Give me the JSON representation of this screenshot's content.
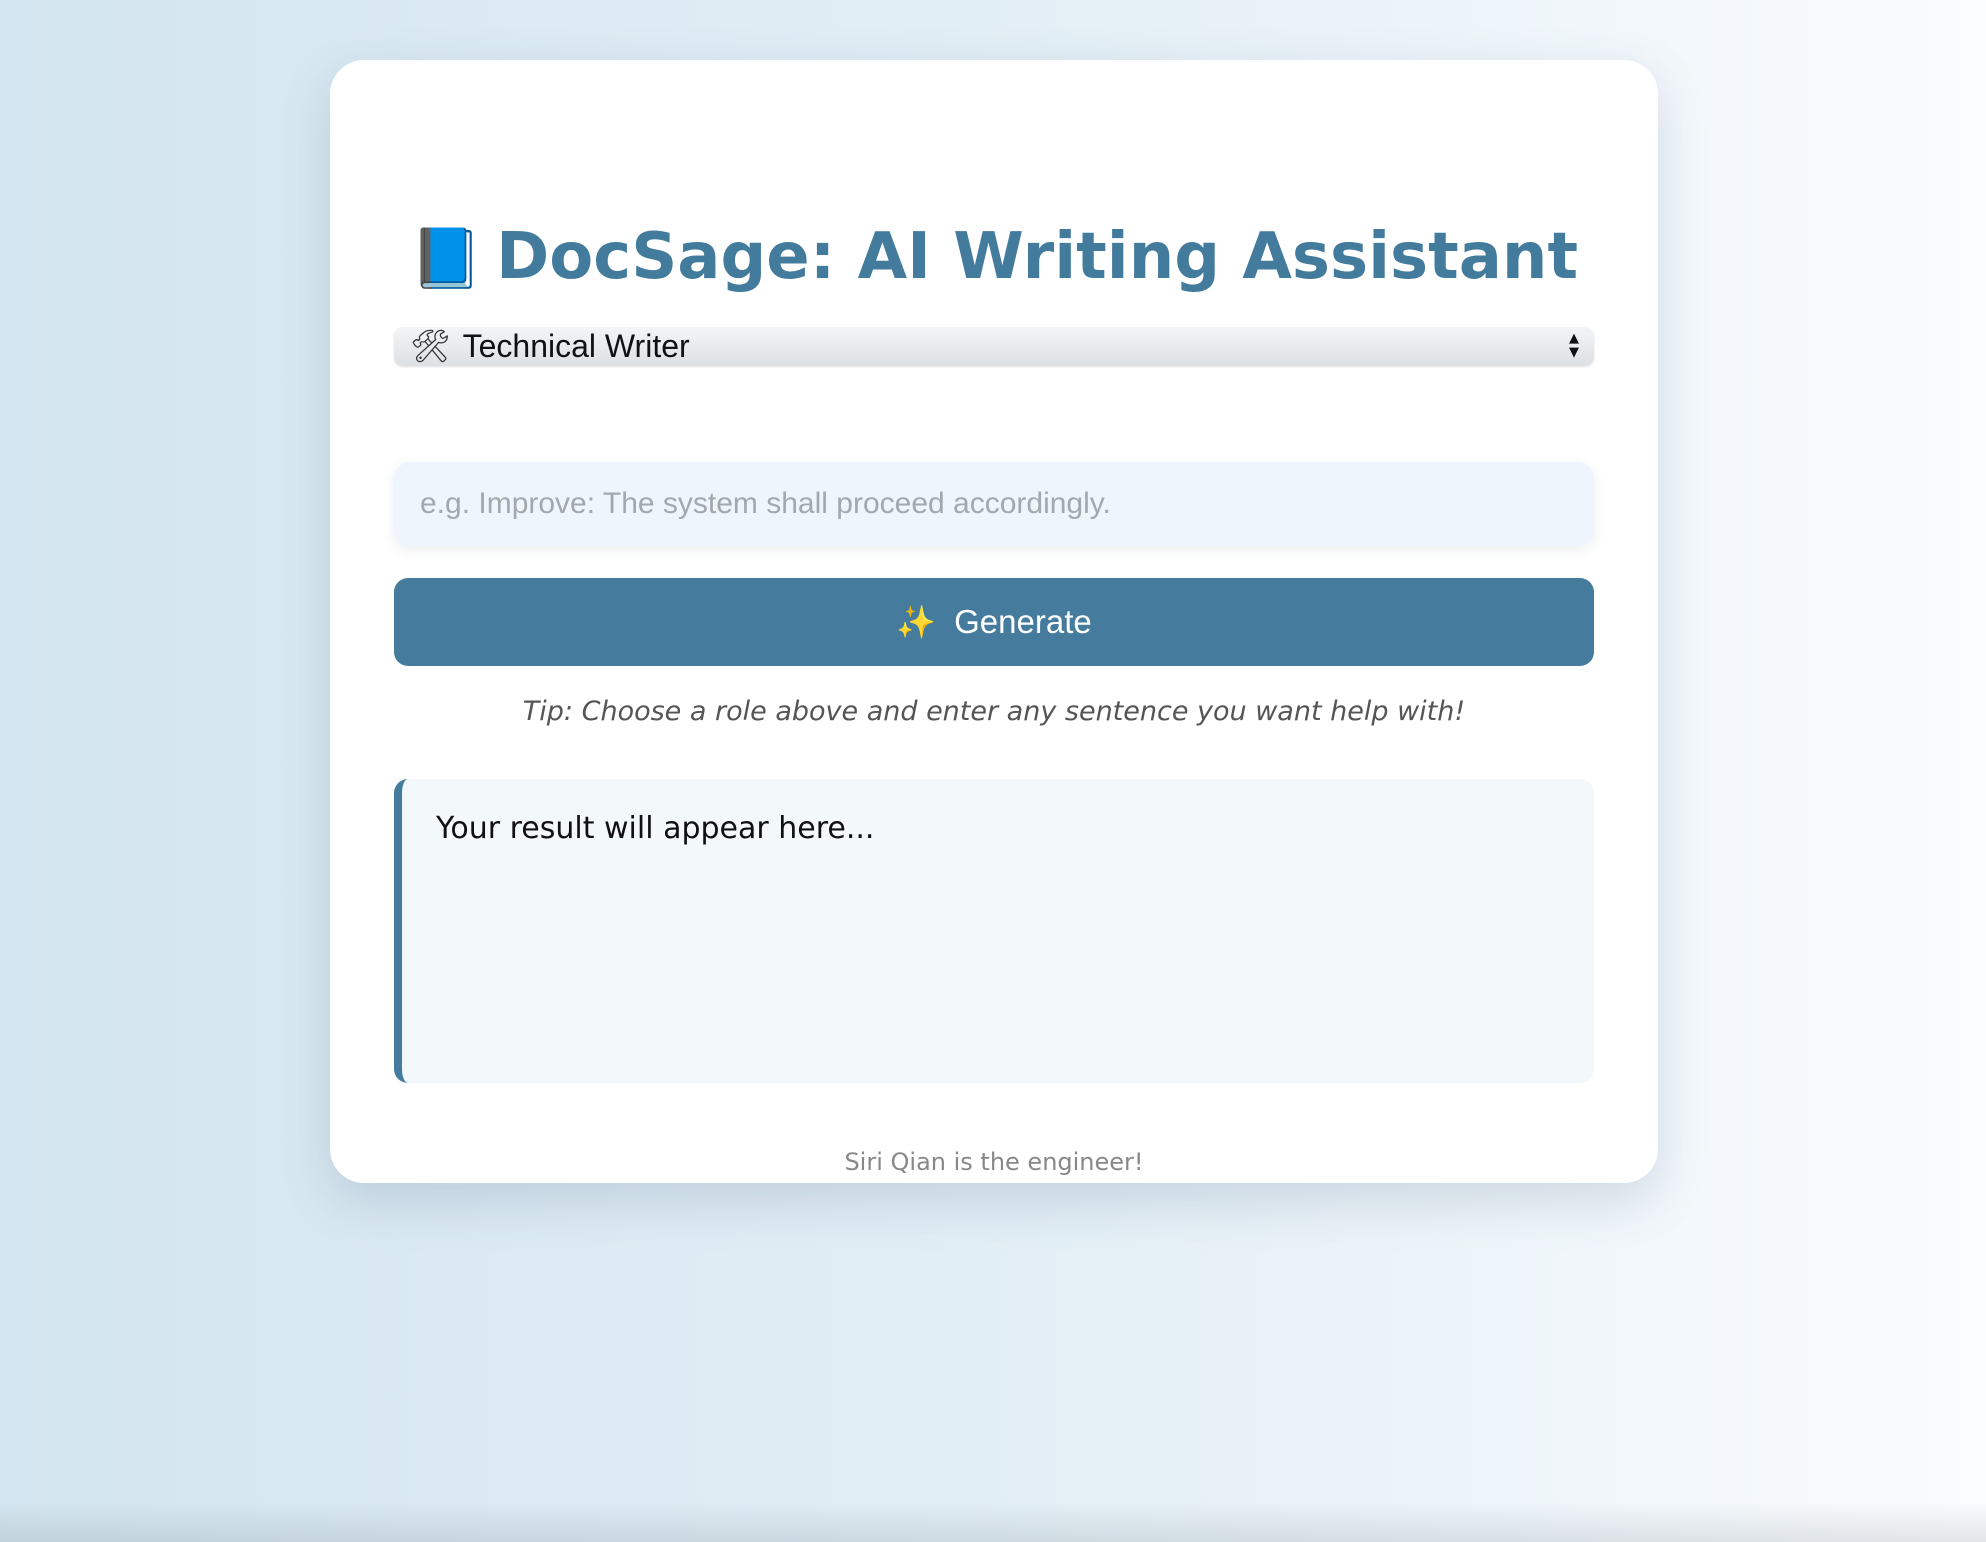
{
  "header": {
    "icon": "blue-book-icon",
    "title": "DocSage: AI Writing Assistant"
  },
  "role_select": {
    "icon": "hammer-wrench-icon",
    "selected": "Technical Writer"
  },
  "prompt": {
    "value": "",
    "placeholder": "e.g. Improve: The system shall proceed accordingly."
  },
  "generate_button": {
    "icon": "sparkles-icon",
    "label": "Generate"
  },
  "tip": "Tip: Choose a role above and enter any sentence you want help with!",
  "result": {
    "text": "Your result will appear here..."
  },
  "footer": "Siri Qian is the engineer!",
  "colors": {
    "accent": "#457b9d",
    "title": "#437b9d",
    "input_bg": "#eef5fc",
    "result_bg": "#f3f8fb"
  }
}
